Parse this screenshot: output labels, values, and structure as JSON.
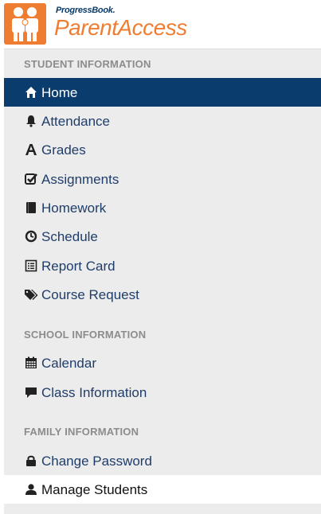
{
  "brand": {
    "small": "ProgressBook.",
    "name": "ParentAccess"
  },
  "colors": {
    "accent": "#ef7d31",
    "nav_active": "#0b3c6e",
    "link": "#1f3d6b",
    "section_heading": "#8c8c8c",
    "menu_bg": "#ececec"
  },
  "sections": {
    "student": "STUDENT INFORMATION",
    "school": "SCHOOL INFORMATION",
    "family": "FAMILY INFORMATION"
  },
  "nav": {
    "home": {
      "label": "Home",
      "icon": "home-icon"
    },
    "attendance": {
      "label": "Attendance",
      "icon": "bell-icon"
    },
    "grades": {
      "label": "Grades",
      "icon": "grades-icon"
    },
    "assignments": {
      "label": "Assignments",
      "icon": "checkbox-icon"
    },
    "homework": {
      "label": "Homework",
      "icon": "book-icon"
    },
    "schedule": {
      "label": "Schedule",
      "icon": "clock-icon"
    },
    "report_card": {
      "label": "Report Card",
      "icon": "list-icon"
    },
    "course_request": {
      "label": "Course Request",
      "icon": "tags-icon"
    },
    "calendar": {
      "label": "Calendar",
      "icon": "calendar-icon"
    },
    "class_info": {
      "label": "Class Information",
      "icon": "comment-icon"
    },
    "change_password": {
      "label": "Change Password",
      "icon": "lock-icon"
    },
    "manage_students": {
      "label": "Manage Students",
      "icon": "user-icon"
    }
  }
}
